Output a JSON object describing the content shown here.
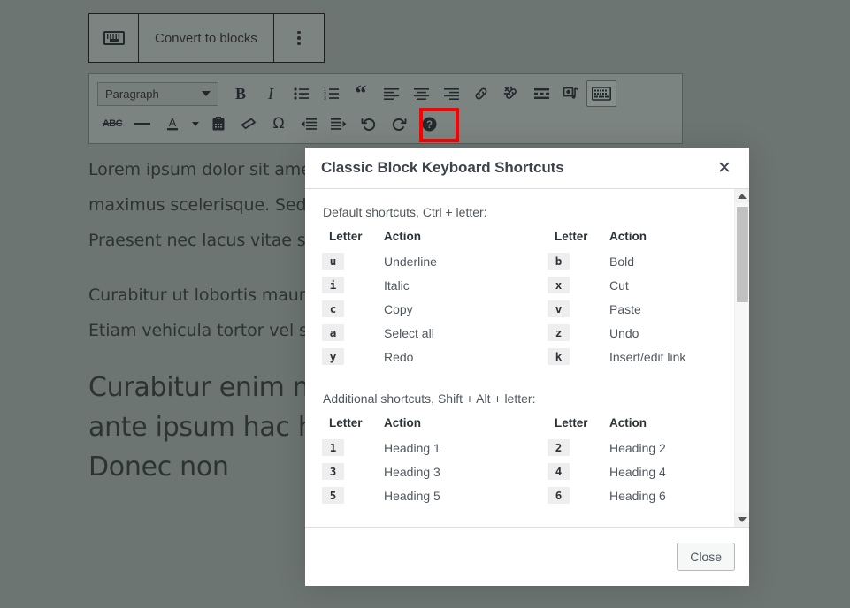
{
  "block_toolbar": {
    "keyboard_icon": "keyboard-icon",
    "convert_label": "Convert to blocks",
    "more_options_icon": "options-vertical-icon"
  },
  "classic_toolbar": {
    "format_select": {
      "value": "Paragraph",
      "caret_icon": "chevron-down-icon"
    },
    "row1": [
      {
        "name": "bold-button",
        "glyph": "B"
      },
      {
        "name": "italic-button",
        "glyph": "I"
      },
      {
        "name": "bulleted-list-button",
        "glyph": "bulleted-list-icon"
      },
      {
        "name": "numbered-list-button",
        "glyph": "numbered-list-icon"
      },
      {
        "name": "blockquote-button",
        "glyph": "quote-icon"
      },
      {
        "name": "align-left-button",
        "glyph": "align-left-icon"
      },
      {
        "name": "align-center-button",
        "glyph": "align-center-icon"
      },
      {
        "name": "align-right-button",
        "glyph": "align-right-icon"
      },
      {
        "name": "insert-link-button",
        "glyph": "link-icon"
      },
      {
        "name": "remove-link-button",
        "glyph": "unlink-icon"
      },
      {
        "name": "read-more-button",
        "glyph": "more-tag-icon"
      },
      {
        "name": "add-media-button",
        "glyph": "media-icon"
      },
      {
        "name": "toolbar-toggle-button",
        "glyph": "keyboard-toolbar-icon"
      }
    ],
    "row2": [
      {
        "name": "strikethrough-button",
        "glyph": "ABC"
      },
      {
        "name": "horizontal-rule-button",
        "glyph": "horizontal-rule-icon"
      },
      {
        "name": "text-color-button",
        "glyph": "text-color-icon"
      },
      {
        "name": "text-color-dropdown",
        "glyph": "chevron-down-icon"
      },
      {
        "name": "paste-as-text-button",
        "glyph": "clipboard-icon"
      },
      {
        "name": "clear-formatting-button",
        "glyph": "eraser-icon"
      },
      {
        "name": "special-character-button",
        "glyph": "omega-icon"
      },
      {
        "name": "decrease-indent-button",
        "glyph": "outdent-icon"
      },
      {
        "name": "increase-indent-button",
        "glyph": "indent-icon"
      },
      {
        "name": "undo-button",
        "glyph": "undo-icon"
      },
      {
        "name": "redo-button",
        "glyph": "redo-icon"
      },
      {
        "name": "keyboard-shortcuts-help-button",
        "glyph": "help-icon"
      }
    ],
    "highlight_color": "#ff0000"
  },
  "document": {
    "paragraphs": [
      "Lorem ipsum dolor sit amet, consectetur adipiscing elit. Integer orci maximus scelerisque. Sed eget risus nec nisi egestas tellus feugiat non. Praesent nec lacus vitae sollicitudin.",
      "Curabitur ut lobortis mauris. Nullam vel ligula vitae dui, quis rutrum orci. Etiam vehicula tortor vel sem."
    ],
    "heading": "Curabitur enim nisi, sollicitudin erat, fames ac ante ipsum hac habitasse platea dictumst. Donec non"
  },
  "modal": {
    "title": "Classic Block Keyboard Shortcuts",
    "close_icon": "close-icon",
    "sections": [
      {
        "intro": "Default shortcuts, Ctrl + letter:",
        "headers": {
          "letter": "Letter",
          "action": "Action"
        },
        "rows": [
          {
            "left_key": "u",
            "left_action": "Underline",
            "right_key": "b",
            "right_action": "Bold"
          },
          {
            "left_key": "i",
            "left_action": "Italic",
            "right_key": "x",
            "right_action": "Cut"
          },
          {
            "left_key": "c",
            "left_action": "Copy",
            "right_key": "v",
            "right_action": "Paste"
          },
          {
            "left_key": "a",
            "left_action": "Select all",
            "right_key": "z",
            "right_action": "Undo"
          },
          {
            "left_key": "y",
            "left_action": "Redo",
            "right_key": "k",
            "right_action": "Insert/edit link"
          }
        ]
      },
      {
        "intro": "Additional shortcuts, Shift + Alt + letter:",
        "headers": {
          "letter": "Letter",
          "action": "Action"
        },
        "rows": [
          {
            "left_key": "1",
            "left_action": "Heading 1",
            "right_key": "2",
            "right_action": "Heading 2"
          },
          {
            "left_key": "3",
            "left_action": "Heading 3",
            "right_key": "4",
            "right_action": "Heading 4"
          },
          {
            "left_key": "5",
            "left_action": "Heading 5",
            "right_key": "6",
            "right_action": "Heading 6"
          }
        ]
      }
    ],
    "scrollbar": {
      "up_icon": "scroll-up-arrow-icon",
      "down_icon": "scroll-down-arrow-icon"
    },
    "footer": {
      "close_label": "Close"
    }
  }
}
